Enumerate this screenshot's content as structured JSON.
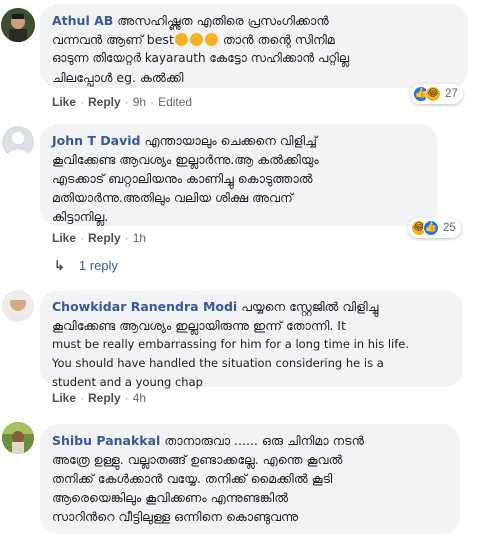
{
  "comments": [
    {
      "author": "Athul AB",
      "lines": [
        "അസഹിഷ്ണുത എതിരെ പ്രസംഗിക്കാൻ",
        "വന്നവൻ ആണ് best",
        "ഓടുന്ന തിയേറ്റർ kayarauth കേട്ടോ സഹിക്കാൻ പറ്റില്ല",
        "ചിലപ്പോൾ eg. കൽക്കി"
      ],
      "line2_suffix": "താൻ തന്റെ സിനിമ",
      "like_label": "Like",
      "reply_label": "Reply",
      "time": "9h",
      "edited_label": "Edited",
      "reaction_count": "27"
    },
    {
      "author": "John T David",
      "lines": [
        "എന്തായാലും ചെക്കനെ വിളിച്ച്",
        "കൂവിക്കേണ്ട ആവശ്യം ഇല്ലാർന്നു.ആ കൽക്കിയും",
        "എടക്കാട് ബറ്റാലിയനും കാണിച്ചു കൊടുത്താൽ",
        "മതിയാർന്നു.അതിലും വലിയ ശിക്ഷ അവന്",
        "കിട്ടാനില്ല."
      ],
      "like_label": "Like",
      "reply_label": "Reply",
      "time": "1h",
      "reaction_count": "25"
    },
    {
      "author": "Chowkidar Ranendra Modi",
      "lines": [
        "പയ്യനെ സ്റ്റേജിൽ വിളിച്ചു",
        "കൂവിക്കേണ്ട ആവശ്യം ഇല്ലായിരുന്നു ഇന്ന് തോന്നി. It",
        "must be really embarrassing for him for a long time in his life.",
        "You should have handled the situation considering he is a",
        "student and a young chap"
      ],
      "like_label": "Like",
      "reply_label": "Reply",
      "time": "4h"
    },
    {
      "author": "Shibu Panakkal",
      "lines": [
        "താനാരുവാ ...... ഒരു ചിനിമാ നടൻ",
        "അത്രേ ഉള്ളു. വല്ലാതങ്ങ് ഉണ്ടാക്കല്ലേ. എന്തെ കൂവൽ",
        "തനിക്ക് കേൾക്കാൻ വയ്യേ. തനിക്ക് മൈക്കിൽ കൂടി",
        "ആരെയെങ്കിലും കൂവിക്കണം എന്നുണ്ടങ്കിൽ",
        "സാറിൻറെ വീട്ടിലുള്ള ഒന്നിനെ കൊണ്ടുവന്നു"
      ]
    }
  ],
  "reply_toggle": {
    "label": "1 reply"
  },
  "colors": {
    "author": "#385898",
    "bubble": "#f2f3f5",
    "meta": "#606770"
  },
  "icons": [
    "like-icon",
    "haha-icon",
    "reply-arrow-icon"
  ]
}
